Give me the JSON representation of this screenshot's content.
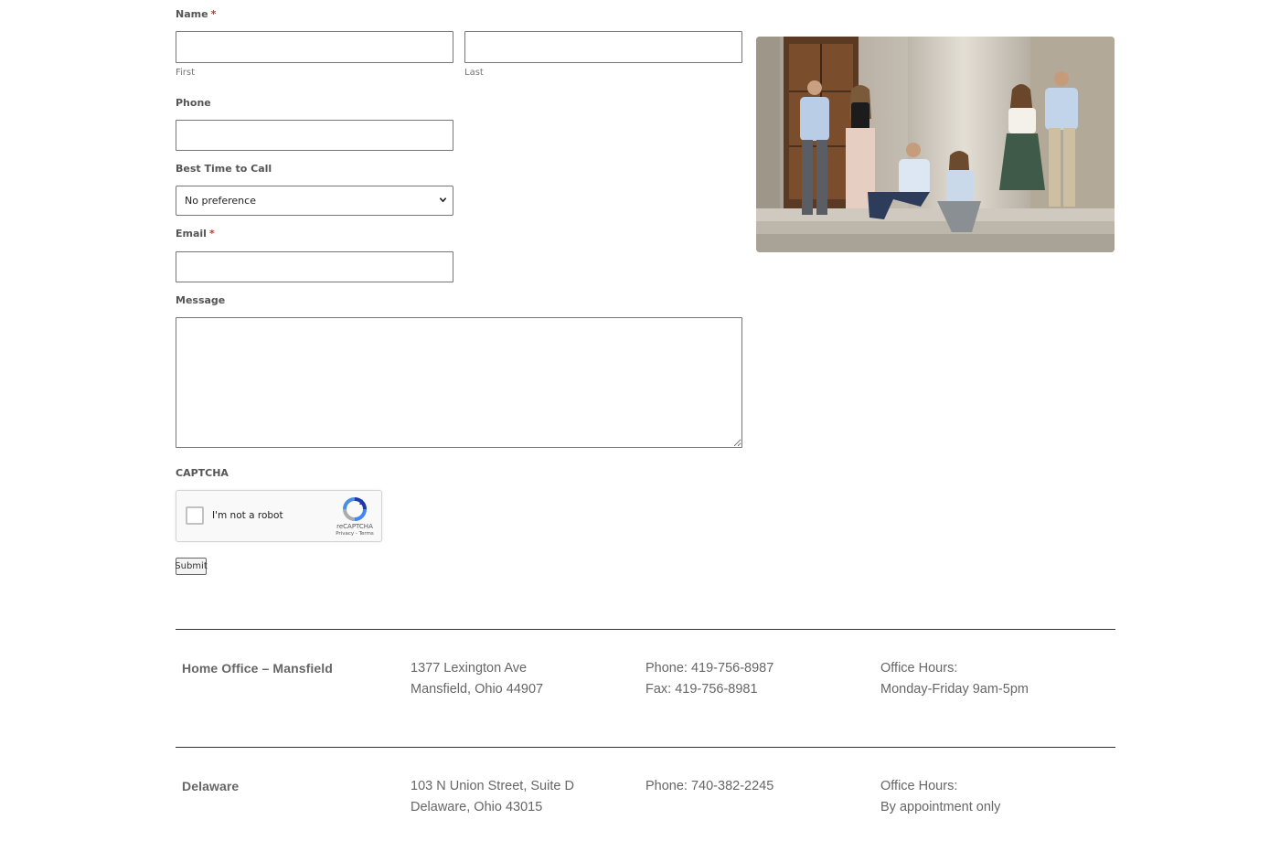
{
  "form": {
    "name_label": "Name",
    "required_mark": "*",
    "first_sublabel": "First",
    "last_sublabel": "Last",
    "first_value": "",
    "last_value": "",
    "phone_label": "Phone",
    "phone_value": "",
    "best_time_label": "Best Time to Call",
    "best_time_selected": "No preference",
    "email_label": "Email",
    "email_value": "",
    "message_label": "Message",
    "message_value": "",
    "captcha_label": "CAPTCHA",
    "recaptcha_text": "I'm not a robot",
    "recaptcha_brand": "reCAPTCHA",
    "recaptcha_links": "Privacy - Terms",
    "submit_label": "Submit"
  },
  "offices": [
    {
      "name": "Home Office – Mansfield",
      "address_line1": "1377 Lexington Ave",
      "address_line2": "Mansfield, Ohio 44907",
      "phone": "Phone: 419-756-8987",
      "fax": "Fax: 419-756-8981",
      "hours_label": "Office Hours:",
      "hours": "Monday-Friday 9am-5pm"
    },
    {
      "name": "Delaware",
      "address_line1": "103 N Union Street, Suite D",
      "address_line2": "Delaware, Ohio 43015",
      "phone": "Phone: 740-382-2245",
      "hours_label": "Office Hours:",
      "hours": "By appointment only"
    }
  ],
  "icons": {
    "select_chevron": "chevron-down-icon",
    "recaptcha_logo": "recaptcha-logo-icon"
  },
  "colors": {
    "required": "#c0392b",
    "rule": "#333333"
  }
}
